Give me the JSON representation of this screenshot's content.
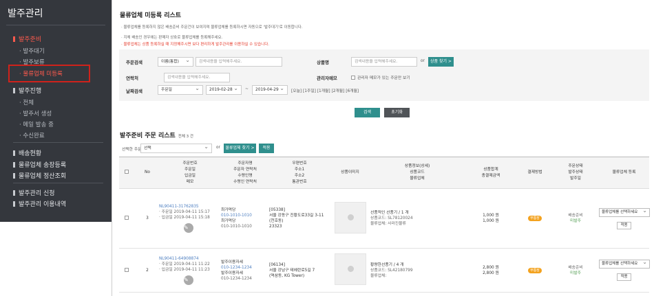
{
  "sidebar": {
    "title": "발주관리",
    "groups": {
      "prep": "발주준비",
      "progress": "발주진행",
      "stock": "배송현황",
      "invoice": "물류업체 송장등록",
      "settle": "물류업체 정산조회",
      "apply": "발주관리 신청",
      "usage": "발주관리 이용내역"
    },
    "prep_items": [
      "· 발주대기",
      "· 발주보류",
      "· 물류업체 미등록"
    ],
    "progress_items": [
      "· 전체",
      "· 발주서 생성",
      "· 메일 발송 중",
      "· 수신완료"
    ]
  },
  "page": {
    "title": "물류업체 미등록 리스트",
    "notes": [
      "· 물류업체를 등록하지 않은 배송준비 주문건이 보여지며 물류업체를 등록하시면 자동으로 '발주대기'로 이동합니다.",
      "· 지체 배송인 경우에는 판매자 상호로 물류업체를 등록해주세요.",
      "· 물류업체는 상품 등록하실 때 지정해주시면 보다 편리하게 발주관리를 이용하실 수 있습니다."
    ]
  },
  "search": {
    "order_label": "주문검색",
    "order_type": "이름(통합)",
    "order_placeholder": "검색내용을 입력해주세요.",
    "product_label": "상품명",
    "product_placeholder": "검색내용을 입력해주세요.",
    "or": "or",
    "product_btn": "상품 찾기 >",
    "contact_label": "연락처",
    "contact_placeholder": "검색내용을 입력해주세요.",
    "memo_label": "관리자메모",
    "memo_option": "관리자 메모가 있는 주문만 보기",
    "date_label": "날짜검색",
    "date_type": "주문일",
    "date_from": "2019-02-28",
    "tilde": "~",
    "date_to": "2019-04-29",
    "quick_dates": "[오늘] [1주일] [1개월] [2개월] [6개월]",
    "search_btn": "검색",
    "reset_btn": "초기화"
  },
  "list": {
    "title": "발주준비 주문 리스트",
    "count": "전체 3 건",
    "bulk_label": "선택한 주문",
    "bulk_select": "선택",
    "or": "or",
    "find_btn": "물류업체 찾기 >",
    "apply_btn": "적용",
    "headers": {
      "no": "No",
      "order": "주문번호\n주문일\n입금일\n메모",
      "buyer": "주문자명\n주문자 연락처\n수령인명\n수령인 연락처",
      "addr": "우편번호\n주소1\n주소2\n통관번호",
      "img": "상품이미지",
      "info": "상품정보(상세)\n상품코드\n물류업체",
      "amount": "상품합계\n총결제금액",
      "pay": "결제방법",
      "status": "주문상태\n발주상태\n발주일",
      "reg": "물류업체 등록"
    },
    "rows": [
      {
        "no": "3",
        "order_no": "NL90411-31762835",
        "order_date": "· 주문일 2019-04-11 15:17",
        "pay_date": "· 입금일 2019-04-11 15:18",
        "buyer": "최가먹당",
        "buyer_tel": "010-1010-1010",
        "receiver": "최가먹당",
        "receiver_tel": "010-1010-1010",
        "zip": "[05338]",
        "addr1": "서울 강동구 진황도로33길 3-11",
        "addr2": "(천호동)",
        "customs": "23323",
        "product": "선풍적인 선풍기 / 1 개",
        "code": "상품코드: SL78120024",
        "vendor": "물류업체: 사라진물류",
        "sum": "1,000 원",
        "total": "1,000 원",
        "pay": "무통장",
        "status": "배송준비",
        "order_status": "미발주",
        "select": "물류업체를 선택하세요",
        "apply": "적용"
      },
      {
        "no": "2",
        "order_no": "NL90411-64908874",
        "order_date": "· 주문일 2019-04-11 11:22",
        "pay_date": "· 입금일 2019-04-11 11:23",
        "buyer": "발주이용자세",
        "buyer_tel": "010-1234-1234",
        "receiver": "발주이용자세",
        "receiver_tel": "010-1234-1234",
        "zip": "[06134]",
        "addr1": "서울 강남구 테헤란로5길 7",
        "addr2": "(역삼동, KG Tower)",
        "customs": "",
        "product": "황량한선풍기 / 4 개",
        "code": "상품코드: SL42180799",
        "vendor": "물류업체:",
        "sum": "2,800 원",
        "total": "2,800 원",
        "pay": "무통장",
        "status": "배송준비",
        "order_status": "미발주",
        "select": "물류업체를 선택하세요",
        "apply": "적용"
      }
    ]
  }
}
